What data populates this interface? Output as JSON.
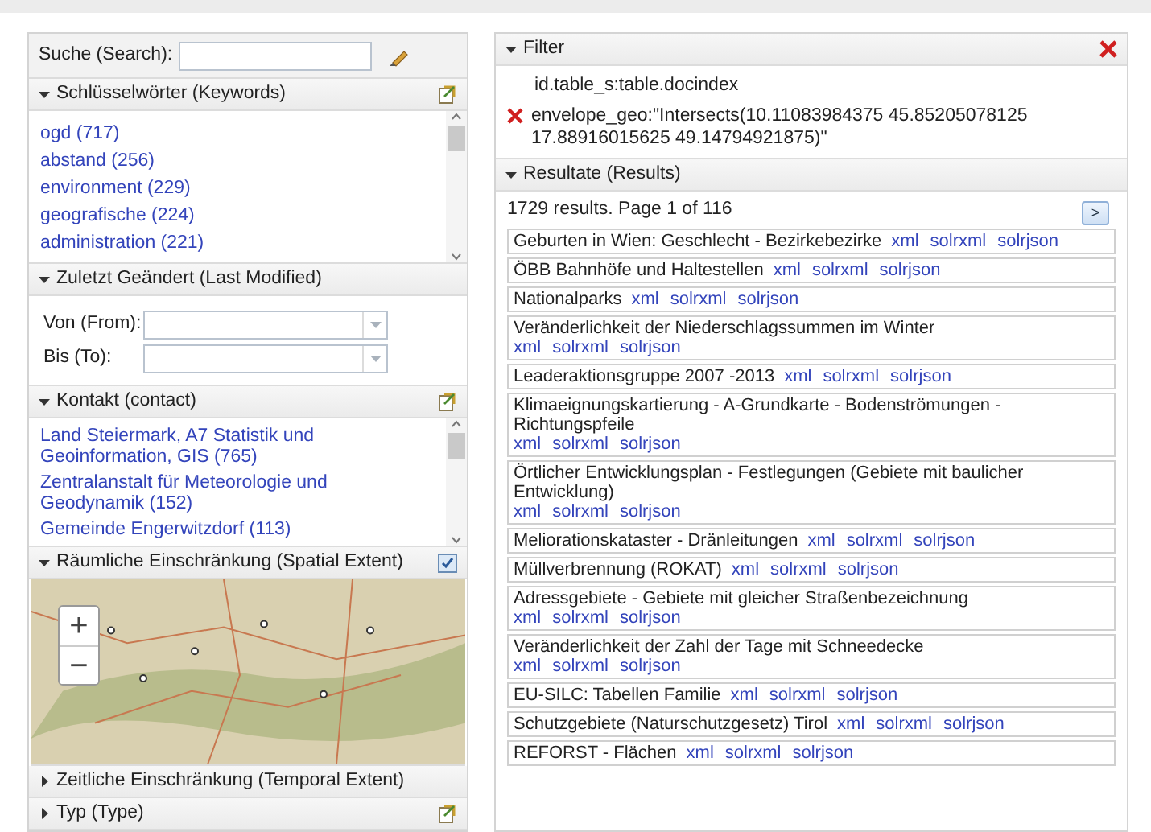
{
  "search": {
    "label": "Suche (Search):"
  },
  "facets": [
    {
      "kind": "list",
      "title": "Schlüsselwörter (Keywords)",
      "expanded": true,
      "icon": true,
      "items": [
        "ogd (717)",
        "abstand (256)",
        "environment (229)",
        "geografische (224)",
        "administration (221)"
      ]
    },
    {
      "kind": "dates",
      "title": "Zuletzt Geändert (Last Modified)",
      "expanded": true,
      "fields": [
        "Von (From):",
        "Bis (To):"
      ]
    },
    {
      "kind": "list",
      "title": "Kontakt (contact)",
      "expanded": true,
      "icon": true,
      "items": [
        "Land Steiermark, A7 Statistik und Geoinformation, GIS (765)",
        "Zentralanstalt für Meteorologie und Geodynamik (152)",
        "Gemeinde Engerwitzdorf (113)"
      ]
    },
    {
      "kind": "map",
      "title": "Räumliche Einschränkung (Spatial Extent)",
      "expanded": true,
      "checked": true,
      "zoom": [
        "+",
        "−"
      ]
    },
    {
      "kind": "none",
      "title": "Zeitliche Einschränkung (Temporal Extent)",
      "expanded": false
    },
    {
      "kind": "none",
      "title": "Typ (Type)",
      "expanded": false,
      "icon": true
    }
  ],
  "filter": {
    "title": "Filter",
    "items": [
      {
        "removable": false,
        "text": "id.table_s:table.docindex"
      },
      {
        "removable": true,
        "text": "envelope_geo:\"Intersects(10.11083984375 45.85205078125 17.88916015625 49.14794921875)\""
      }
    ]
  },
  "results": {
    "title": "Resultate (Results)",
    "summary": "1729 results. Page 1 of 116",
    "next": ">",
    "items": [
      {
        "title": "Geburten in Wien: Geschlecht - Bezirkebezirke",
        "links": [
          "xml",
          "solrxml",
          "solrjson"
        ]
      },
      {
        "title": "ÖBB Bahnhöfe und Haltestellen",
        "links": [
          "xml",
          "solrxml",
          "solrjson"
        ]
      },
      {
        "title": "Nationalparks",
        "links": [
          "xml",
          "solrxml",
          "solrjson"
        ]
      },
      {
        "title": "Veränderlichkeit der Niederschlagssummen im Winter",
        "links": [
          "xml",
          "solrxml",
          "solrjson"
        ]
      },
      {
        "title": "Leaderaktionsgruppe 2007 -2013",
        "links": [
          "xml",
          "solrxml",
          "solrjson"
        ]
      },
      {
        "title": "Klimaeignungskartierung - A-Grundkarte - Bodenströmungen - Richtungspfeile",
        "links": [
          "xml",
          "solrxml",
          "solrjson"
        ]
      },
      {
        "title": "Örtlicher Entwicklungsplan - Festlegungen (Gebiete mit baulicher Entwicklung)",
        "links": [
          "xml",
          "solrxml",
          "solrjson"
        ]
      },
      {
        "title": "Meliorationskataster - Dränleitungen",
        "links": [
          "xml",
          "solrxml",
          "solrjson"
        ]
      },
      {
        "title": "Müllverbrennung (ROKAT)",
        "links": [
          "xml",
          "solrxml",
          "solrjson"
        ]
      },
      {
        "title": "Adressgebiete - Gebiete mit gleicher Straßenbezeichnung",
        "links": [
          "xml",
          "solrxml",
          "solrjson"
        ]
      },
      {
        "title": "Veränderlichkeit der Zahl der Tage mit Schneedecke",
        "links": [
          "xml",
          "solrxml",
          "solrjson"
        ]
      },
      {
        "title": "EU-SILC: Tabellen Familie",
        "links": [
          "xml",
          "solrxml",
          "solrjson"
        ]
      },
      {
        "title": "Schutzgebiete (Naturschutzgesetz) Tirol",
        "links": [
          "xml",
          "solrxml",
          "solrjson"
        ]
      },
      {
        "title": "REFORST - Flächen",
        "links": [
          "xml",
          "solrxml",
          "solrjson"
        ]
      }
    ]
  }
}
